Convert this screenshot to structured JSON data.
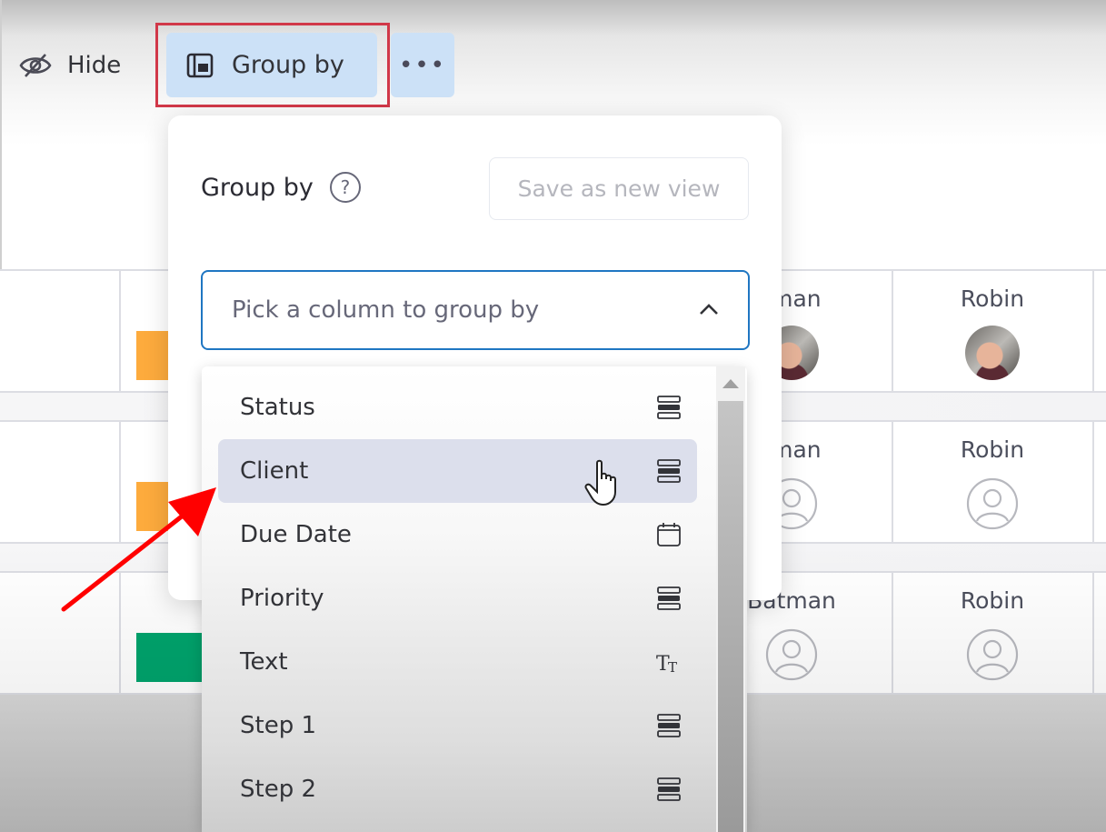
{
  "toolbar": {
    "hide_label": "Hide",
    "group_by_label": "Group by",
    "more_label": "•••"
  },
  "popover": {
    "title": "Group by",
    "help_symbol": "?",
    "save_view_label": "Save as new view",
    "select_placeholder": "Pick a column to group by"
  },
  "dropdown": {
    "items": [
      {
        "label": "Status",
        "icon": "status-column-icon"
      },
      {
        "label": "Client",
        "icon": "status-column-icon",
        "hovered": true
      },
      {
        "label": "Due Date",
        "icon": "calendar-icon"
      },
      {
        "label": "Priority",
        "icon": "status-column-icon"
      },
      {
        "label": "Text",
        "icon": "text-column-icon"
      },
      {
        "label": "Step 1",
        "icon": "status-column-icon"
      },
      {
        "label": "Step 2",
        "icon": "status-column-icon"
      }
    ]
  },
  "board": {
    "rows": [
      {
        "status_color": "#fdab3d",
        "person_a": "Batman",
        "person_a_visible": "tman",
        "person_b": "Robin",
        "avatar": "photo"
      },
      {
        "status_color": "#fdab3d",
        "person_a": "Batman",
        "person_a_visible": "tman",
        "person_b": "Robin",
        "avatar": "empty"
      },
      {
        "status_color": "#00a36c",
        "person_a": "Batman",
        "person_a_visible": "Batman",
        "person_b": "Robin",
        "avatar": "empty"
      }
    ]
  },
  "colors": {
    "accent_blue": "#1f76c2",
    "button_selected_bg": "#cce1f7",
    "highlight_red": "#d13849",
    "annotation_arrow": "#ff0000",
    "status_orange": "#fdab3d",
    "status_green": "#00a36c"
  }
}
